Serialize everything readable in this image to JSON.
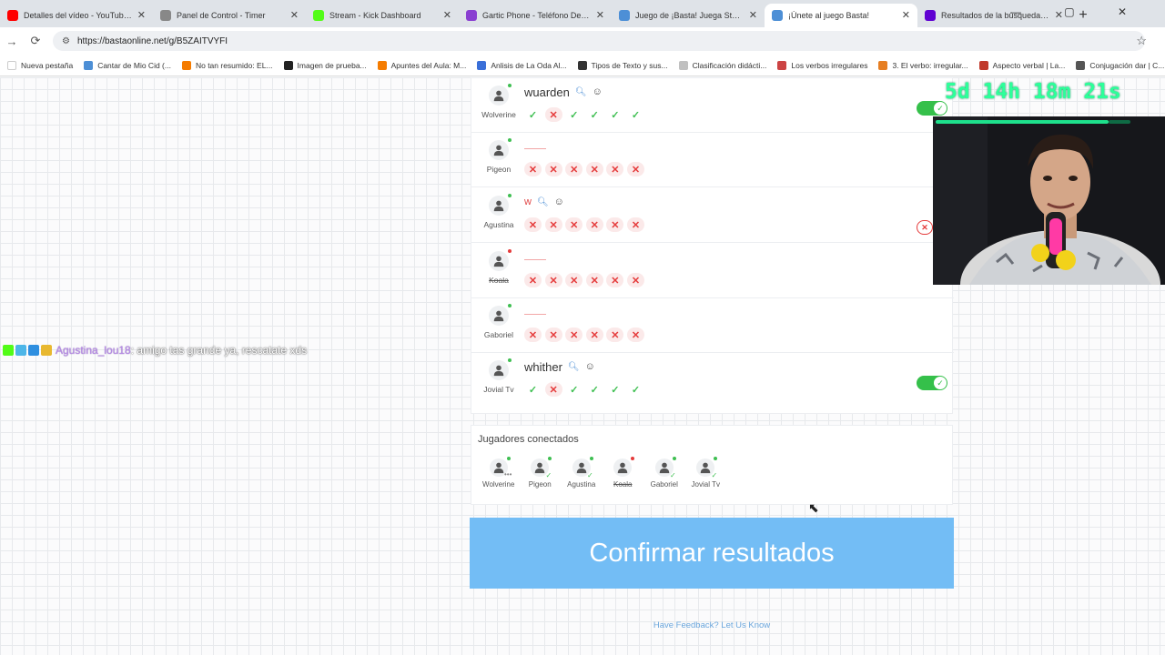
{
  "browser": {
    "tabs": [
      {
        "title": "Detalles del vídeo - YouTube St",
        "color": "#ff0000"
      },
      {
        "title": "Panel de Control - Timer",
        "color": "#888888"
      },
      {
        "title": "Stream - Kick Dashboard",
        "color": "#53fc18"
      },
      {
        "title": "Gartic Phone - Teléfono Desco",
        "color": "#8a3fd1"
      },
      {
        "title": "Juego de ¡Basta! Juega Stop, Tu",
        "color": "#4d8fd6"
      },
      {
        "title": "¡Únete al juego Basta!",
        "color": "#4d8fd6",
        "active": true
      },
      {
        "title": "Resultados de la búsqueda de",
        "color": "#6001d2"
      }
    ],
    "new_tab": "+",
    "url": "https://bastaonline.net/g/B5ZAITVYFI",
    "bookmarks": [
      {
        "label": "Nueva pestaña",
        "color": "#ffffff"
      },
      {
        "label": "Cantar de Mio Cid (...",
        "color": "#4d8fd6"
      },
      {
        "label": "No tan resumido: EL...",
        "color": "#f57c00"
      },
      {
        "label": "Imagen de prueba...",
        "color": "#222222"
      },
      {
        "label": "Apuntes del Aula: M...",
        "color": "#f57c00"
      },
      {
        "label": "Anlisis de La Oda Al...",
        "color": "#3a6fd8"
      },
      {
        "label": "Tipos de Texto y sus...",
        "color": "#333333"
      },
      {
        "label": "Clasificación didácti...",
        "color": "#c0c0c0"
      },
      {
        "label": "Los verbos irregulares",
        "color": "#c44"
      },
      {
        "label": "3. El verbo: irregular...",
        "color": "#e67e22"
      },
      {
        "label": "Aspecto verbal | La...",
        "color": "#c0392b"
      },
      {
        "label": "Conjugación dar | C...",
        "color": "#555555"
      }
    ]
  },
  "players": [
    {
      "name": "Wolverine",
      "word": "wuarden",
      "status_color": "#3fbf52",
      "marks": [
        "ok",
        "bad",
        "ok",
        "ok",
        "ok",
        "ok"
      ],
      "control": "toggle-on"
    },
    {
      "name": "Pigeon",
      "word": "",
      "status_color": "#3fbf52",
      "marks": [
        "bad",
        "bad",
        "bad",
        "bad",
        "bad",
        "bad"
      ],
      "control": "none"
    },
    {
      "name": "Agustina",
      "word": "w",
      "status_color": "#3fbf52",
      "marks": [
        "bad",
        "bad",
        "bad",
        "bad",
        "bad",
        "bad"
      ],
      "control": "x-badge"
    },
    {
      "name": "Koala",
      "word": "",
      "status_color": "#e53b3b",
      "marks": [
        "bad",
        "bad",
        "bad",
        "bad",
        "bad",
        "bad"
      ],
      "control": "none",
      "struck": true
    },
    {
      "name": "Gaboriel",
      "word": "",
      "status_color": "#3fbf52",
      "marks": [
        "bad",
        "bad",
        "bad",
        "bad",
        "bad",
        "bad"
      ],
      "control": "none"
    },
    {
      "name": "Jovial Tv",
      "word": "whither",
      "status_color": "#3fbf52",
      "marks": [
        "ok",
        "bad",
        "ok",
        "ok",
        "ok",
        "ok"
      ],
      "control": "toggle-on"
    }
  ],
  "connected": {
    "title": "Jugadores conectados",
    "players": [
      {
        "name": "Wolverine",
        "status_color": "#3fbf52",
        "state": "typing"
      },
      {
        "name": "Pigeon",
        "status_color": "#3fbf52",
        "state": "ready"
      },
      {
        "name": "Agustina",
        "status_color": "#3fbf52",
        "state": "ready"
      },
      {
        "name": "Koala",
        "status_color": "#e53b3b",
        "state": "none",
        "struck": true
      },
      {
        "name": "Gaboriel",
        "status_color": "#3fbf52",
        "state": "ready"
      },
      {
        "name": "Jovial Tv",
        "status_color": "#3fbf52",
        "state": "ready"
      }
    ]
  },
  "confirm_button": "Confirmar resultados",
  "feedback_link": "Have Feedback? Let Us Know",
  "chat": {
    "user": "Agustina_lou18",
    "message": ": amigo tas grande ya, rescatate xds"
  },
  "timer": "5d 14h 18m 21s",
  "timer_progress": 0.89
}
